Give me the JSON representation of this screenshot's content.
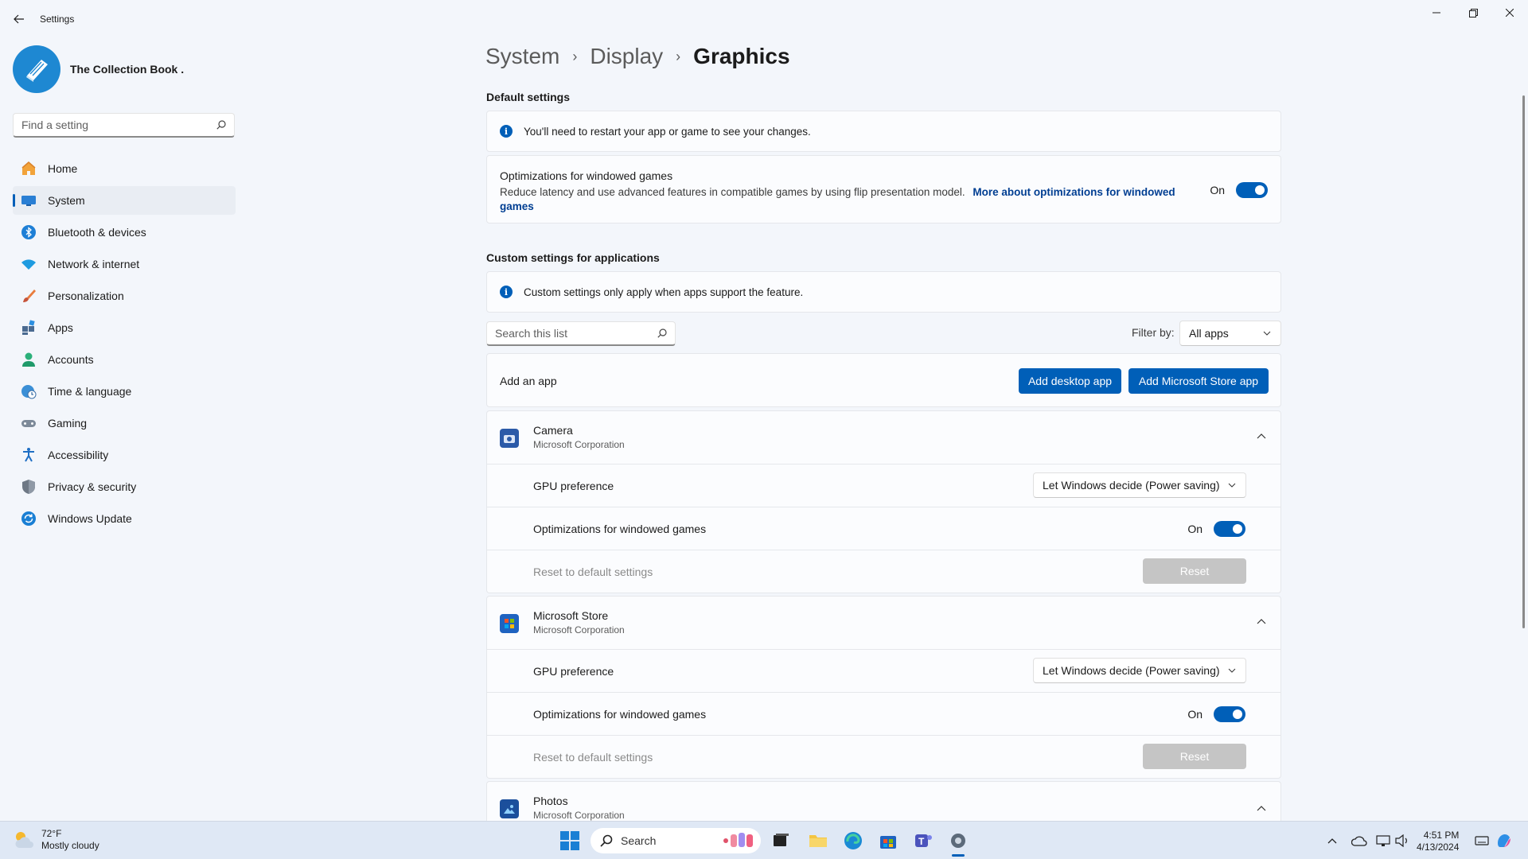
{
  "window": {
    "title": "Settings"
  },
  "profile": {
    "name": "The Collection Book ."
  },
  "search": {
    "placeholder": "Find a setting"
  },
  "sidebar": {
    "items": [
      {
        "label": "Home"
      },
      {
        "label": "System"
      },
      {
        "label": "Bluetooth & devices"
      },
      {
        "label": "Network & internet"
      },
      {
        "label": "Personalization"
      },
      {
        "label": "Apps"
      },
      {
        "label": "Accounts"
      },
      {
        "label": "Time & language"
      },
      {
        "label": "Gaming"
      },
      {
        "label": "Accessibility"
      },
      {
        "label": "Privacy & security"
      },
      {
        "label": "Windows Update"
      }
    ]
  },
  "breadcrumb": {
    "items": [
      "System",
      "Display",
      "Graphics"
    ]
  },
  "default_settings": {
    "title": "Default settings",
    "info": "You'll need to restart your app or game to see your changes.",
    "windowed": {
      "title": "Optimizations for windowed games",
      "description": "Reduce latency and use advanced features in compatible games by using flip presentation model.",
      "link": "More about optimizations for windowed games",
      "state": "On"
    }
  },
  "custom_settings": {
    "title": "Custom settings for applications",
    "info": "Custom settings only apply when apps support the feature.",
    "search_placeholder": "Search this list",
    "filter_label": "Filter by:",
    "filter_value": "All apps",
    "add_app_label": "Add an app",
    "add_desktop_btn": "Add desktop app",
    "add_store_btn": "Add Microsoft Store app"
  },
  "apps": [
    {
      "name": "Camera",
      "publisher": "Microsoft Corporation",
      "gpu_label": "GPU preference",
      "gpu_value": "Let Windows decide (Power saving)",
      "windowed_label": "Optimizations for windowed games",
      "windowed_state": "On",
      "reset_label": "Reset to default settings",
      "reset_btn": "Reset"
    },
    {
      "name": "Microsoft Store",
      "publisher": "Microsoft Corporation",
      "gpu_label": "GPU preference",
      "gpu_value": "Let Windows decide (Power saving)",
      "windowed_label": "Optimizations for windowed games",
      "windowed_state": "On",
      "reset_label": "Reset to default settings",
      "reset_btn": "Reset"
    },
    {
      "name": "Photos",
      "publisher": "Microsoft Corporation"
    }
  ],
  "taskbar": {
    "temperature": "72°F",
    "condition": "Mostly cloudy",
    "search_label": "Search",
    "time": "4:51 PM",
    "date": "4/13/2024"
  },
  "colors": {
    "accent": "#005fb8",
    "background": "#f3f6fb"
  }
}
